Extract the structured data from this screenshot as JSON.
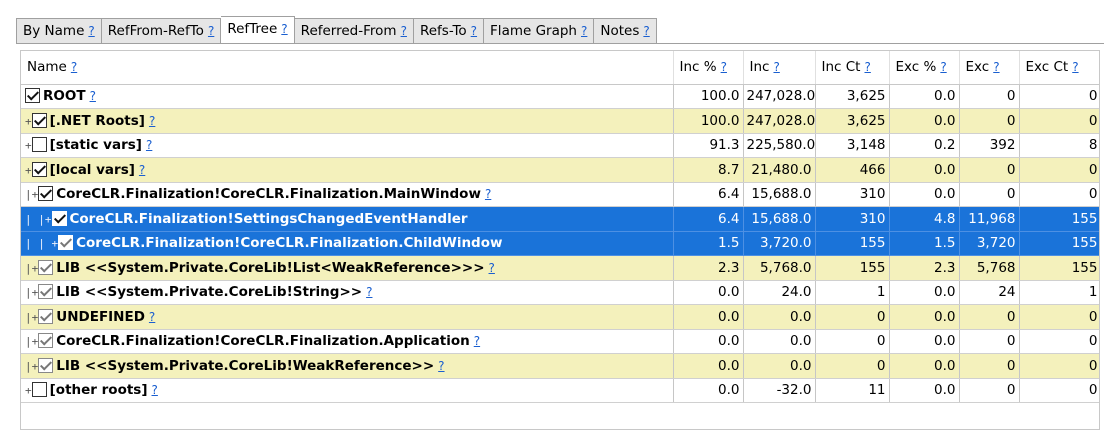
{
  "help_mark": "?",
  "tabs": [
    {
      "label": "By Name",
      "active": false
    },
    {
      "label": "RefFrom-RefTo",
      "active": false
    },
    {
      "label": "RefTree",
      "active": true
    },
    {
      "label": "Referred-From",
      "active": false
    },
    {
      "label": "Refs-To",
      "active": false
    },
    {
      "label": "Flame Graph",
      "active": false
    },
    {
      "label": "Notes",
      "active": false
    }
  ],
  "columns": [
    "Name",
    "Inc %",
    "Inc",
    "Inc Ct",
    "Exc %",
    "Exc",
    "Exc Ct"
  ],
  "rows": [
    {
      "guide": "",
      "expander": "",
      "checked": true,
      "dim": false,
      "name": "ROOT",
      "help": true,
      "style": "white",
      "inc_pct": "100.0",
      "inc": "247,028.0",
      "inc_ct": "3,625",
      "exc_pct": "0.0",
      "exc": "0",
      "exc_ct": "0"
    },
    {
      "guide": "",
      "expander": "+",
      "checked": true,
      "dim": false,
      "name": "[.NET Roots]",
      "help": true,
      "style": "yellow",
      "inc_pct": "100.0",
      "inc": "247,028.0",
      "inc_ct": "3,625",
      "exc_pct": "0.0",
      "exc": "0",
      "exc_ct": "0"
    },
    {
      "guide": " ",
      "expander": "+",
      "checked": false,
      "dim": false,
      "name": "[static vars]",
      "help": true,
      "style": "white",
      "inc_pct": "91.3",
      "inc": "225,580.0",
      "inc_ct": "3,148",
      "exc_pct": "0.2",
      "exc": "392",
      "exc_ct": "8"
    },
    {
      "guide": " ",
      "expander": "+",
      "checked": true,
      "dim": false,
      "name": "[local vars]",
      "help": true,
      "style": "yellow",
      "inc_pct": "8.7",
      "inc": "21,480.0",
      "inc_ct": "466",
      "exc_pct": "0.0",
      "exc": "0",
      "exc_ct": "0"
    },
    {
      "guide": " |",
      "expander": "+",
      "checked": true,
      "dim": false,
      "name": "CoreCLR.Finalization!CoreCLR.Finalization.MainWindow",
      "help": true,
      "style": "white",
      "inc_pct": "6.4",
      "inc": "15,688.0",
      "inc_ct": "310",
      "exc_pct": "0.0",
      "exc": "0",
      "exc_ct": "0"
    },
    {
      "guide": " | |",
      "expander": "+",
      "checked": true,
      "dim": false,
      "name": "CoreCLR.Finalization!SettingsChangedEventHandler",
      "help": false,
      "style": "selected",
      "inc_pct": "6.4",
      "inc": "15,688.0",
      "inc_ct": "310",
      "exc_pct": "4.8",
      "exc": "11,968",
      "exc_ct": "155"
    },
    {
      "guide": " | |  ",
      "expander": "+",
      "checked": true,
      "dim": true,
      "name": "CoreCLR.Finalization!CoreCLR.Finalization.ChildWindow",
      "help": false,
      "style": "selected",
      "inc_pct": "1.5",
      "inc": "3,720.0",
      "inc_ct": "155",
      "exc_pct": "1.5",
      "exc": "3,720",
      "exc_ct": "155"
    },
    {
      "guide": " |",
      "expander": "+",
      "checked": true,
      "dim": true,
      "name": "LIB <<System.Private.CoreLib!List<WeakReference>>>",
      "help": true,
      "style": "yellow",
      "inc_pct": "2.3",
      "inc": "5,768.0",
      "inc_ct": "155",
      "exc_pct": "2.3",
      "exc": "5,768",
      "exc_ct": "155"
    },
    {
      "guide": " |",
      "expander": "+",
      "checked": true,
      "dim": true,
      "name": "LIB <<System.Private.CoreLib!String>>",
      "help": true,
      "style": "white",
      "inc_pct": "0.0",
      "inc": "24.0",
      "inc_ct": "1",
      "exc_pct": "0.0",
      "exc": "24",
      "exc_ct": "1"
    },
    {
      "guide": " |",
      "expander": "+",
      "checked": true,
      "dim": true,
      "name": "UNDEFINED",
      "help": true,
      "style": "yellow",
      "inc_pct": "0.0",
      "inc": "0.0",
      "inc_ct": "0",
      "exc_pct": "0.0",
      "exc": "0",
      "exc_ct": "0"
    },
    {
      "guide": " |",
      "expander": "+",
      "checked": true,
      "dim": true,
      "name": "CoreCLR.Finalization!CoreCLR.Finalization.Application",
      "help": true,
      "style": "white",
      "inc_pct": "0.0",
      "inc": "0.0",
      "inc_ct": "0",
      "exc_pct": "0.0",
      "exc": "0",
      "exc_ct": "0"
    },
    {
      "guide": " |",
      "expander": "+",
      "checked": true,
      "dim": true,
      "name": "LIB <<System.Private.CoreLib!WeakReference>>",
      "help": true,
      "style": "yellow",
      "inc_pct": "0.0",
      "inc": "0.0",
      "inc_ct": "0",
      "exc_pct": "0.0",
      "exc": "0",
      "exc_ct": "0"
    },
    {
      "guide": "",
      "expander": "+",
      "checked": false,
      "dim": false,
      "name": "[other roots]",
      "help": true,
      "style": "white",
      "inc_pct": "0.0",
      "inc": "-32.0",
      "inc_ct": "11",
      "exc_pct": "0.0",
      "exc": "0",
      "exc_ct": "0"
    }
  ]
}
